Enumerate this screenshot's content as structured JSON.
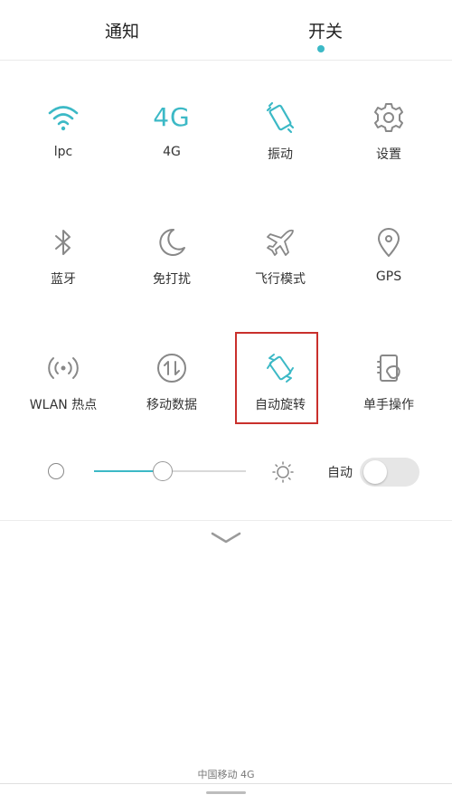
{
  "tabs": {
    "notify": "通知",
    "switch": "开关",
    "active": "开关"
  },
  "tiles": [
    {
      "label": "lpc",
      "icon": "wifi-icon",
      "active": true
    },
    {
      "label": "4G",
      "icon": "4g-icon",
      "active": true
    },
    {
      "label": "振动",
      "icon": "vibration-icon",
      "active": true
    },
    {
      "label": "设置",
      "icon": "settings-icon",
      "active": false
    },
    {
      "label": "蓝牙",
      "icon": "bluetooth-icon",
      "active": false
    },
    {
      "label": "免打扰",
      "icon": "moon-icon",
      "active": false
    },
    {
      "label": "飞行模式",
      "icon": "airplane-icon",
      "active": false
    },
    {
      "label": "GPS",
      "icon": "location-pin-icon",
      "active": false
    },
    {
      "label": "WLAN 热点",
      "icon": "hotspot-icon",
      "active": false
    },
    {
      "label": "移动数据",
      "icon": "mobile-data-icon",
      "active": false
    },
    {
      "label": "自动旋转",
      "icon": "auto-rotate-icon",
      "active": true
    },
    {
      "label": "单手操作",
      "icon": "one-hand-icon",
      "active": false
    }
  ],
  "tile_4g_glyph": "4G",
  "brightness": {
    "level": 0.45,
    "auto_label": "自动",
    "auto_enabled": false
  },
  "footer": {
    "carrier": "中国移动 4G"
  },
  "colors": {
    "accent": "#3cb9c6",
    "highlight": "#c9302c",
    "icon": "#888888"
  }
}
